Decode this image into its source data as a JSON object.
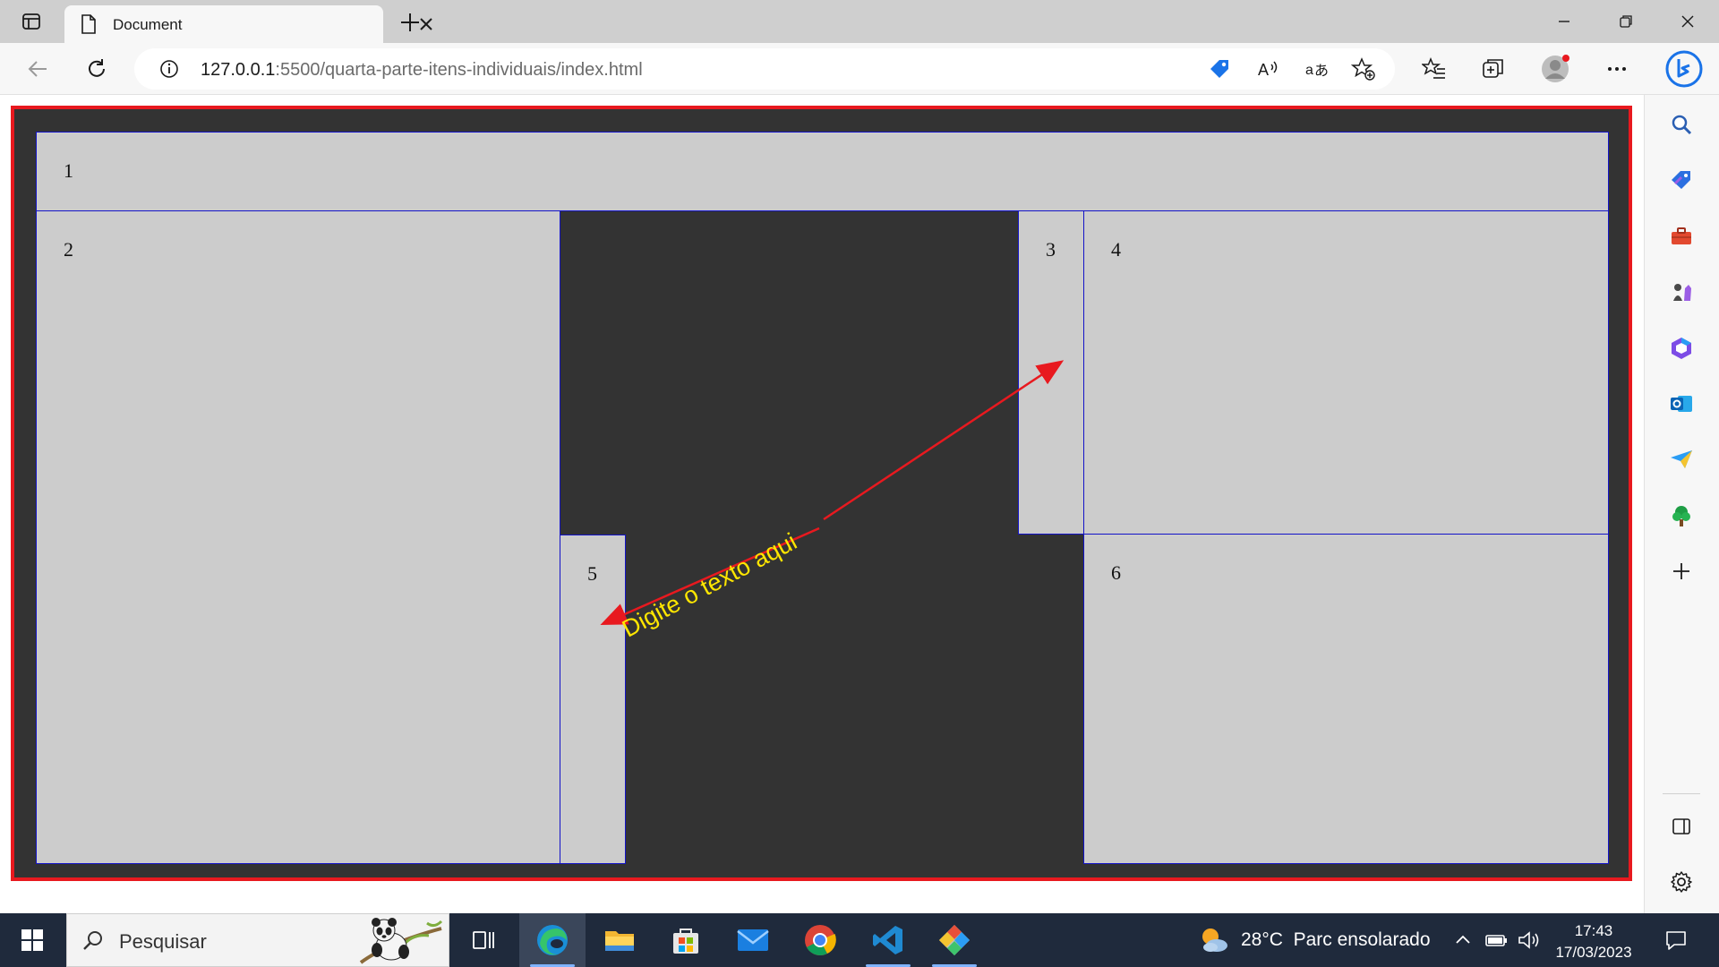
{
  "browser": {
    "tab_title": "Document",
    "url_host": "127.0.0.1",
    "url_path": ":5500/quarta-parte-itens-individuais/index.html"
  },
  "page": {
    "cells": [
      "1",
      "2",
      "3",
      "4",
      "5",
      "6"
    ],
    "annotation_text": "Digite o texto aqui"
  },
  "taskbar": {
    "search_placeholder": "Pesquisar",
    "weather_temp": "28°C",
    "weather_desc": "Parc ensolarado",
    "time": "17:43",
    "date": "17/03/2023"
  },
  "colors": {
    "page_background": "#333333",
    "cell_background": "#cccccc",
    "cell_border": "#1313c8",
    "container_border": "#e8191f",
    "annotation_text": "#ffe600",
    "annotation_arrow": "#e8191f"
  }
}
